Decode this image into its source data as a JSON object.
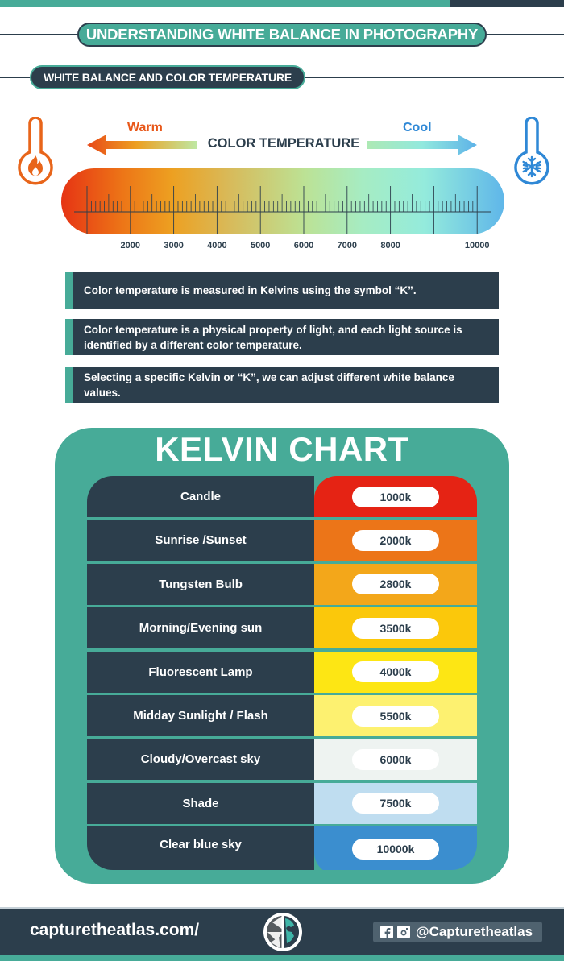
{
  "header": {
    "title": "UNDERSTANDING WHITE BALANCE IN PHOTOGRAPHY",
    "section_title": "WHITE BALANCE AND COLOR TEMPERATURE"
  },
  "temperature_scale": {
    "warm_label": "Warm",
    "cool_label": "Cool",
    "title": "COLOR TEMPERATURE",
    "tick_labels": [
      "2000",
      "3000",
      "4000",
      "5000",
      "6000",
      "7000",
      "8000",
      "10000"
    ],
    "icons": {
      "left": "thermometer-fire-icon",
      "right": "thermometer-snowflake-icon"
    },
    "colors": {
      "warm": "#e8581a",
      "cool": "#2f88d6"
    }
  },
  "info": [
    "Color temperature is measured in Kelvins using the symbol “K”.",
    "Color temperature is a physical property of light, and each light source is identified by a different color temperature.",
    "Selecting a specific Kelvin or “K”, we can adjust different white balance values."
  ],
  "kelvin_chart": {
    "title": "KELVIN CHART",
    "rows": [
      {
        "source": "Candle",
        "value": "1000k",
        "color": "#e52314"
      },
      {
        "source": "Sunrise /Sunset",
        "value": "2000k",
        "color": "#ec7518"
      },
      {
        "source": "Tungsten Bulb",
        "value": "2800k",
        "color": "#f3a71a"
      },
      {
        "source": "Morning/Evening sun",
        "value": "3500k",
        "color": "#fbc80b"
      },
      {
        "source": "Fluorescent Lamp",
        "value": "4000k",
        "color": "#fde614"
      },
      {
        "source": "Midday Sunlight / Flash",
        "value": "5500k",
        "color": "#fdf170"
      },
      {
        "source": "Cloudy/Overcast sky",
        "value": "6000k",
        "color": "#eef3f1"
      },
      {
        "source": "Shade",
        "value": "7500k",
        "color": "#bfddf0"
      },
      {
        "source": "Clear blue sky",
        "value": "10000k",
        "color": "#3b8ecf"
      }
    ]
  },
  "footer": {
    "site": "capturetheatlas.com/",
    "handle": "@Capturetheatlas",
    "logo": "aperture-globe-logo",
    "social_icons": [
      "facebook-icon",
      "instagram-icon"
    ]
  },
  "brand_colors": {
    "teal": "#47ab98",
    "navy": "#2c3e4c"
  }
}
